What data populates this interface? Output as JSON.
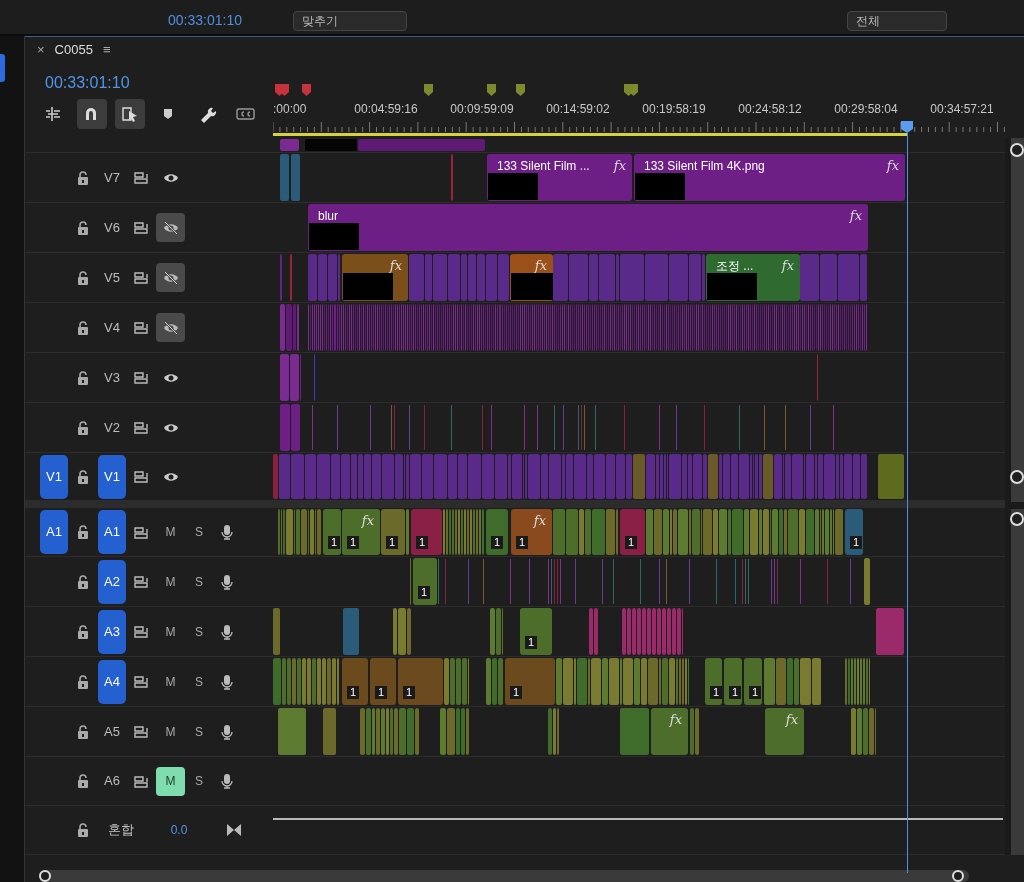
{
  "program_monitor": {
    "timecode": "00:33:01:10",
    "zoom_select": "맞추기",
    "quality_select": "전체"
  },
  "sequence": {
    "close": "×",
    "title": "C0055",
    "menu": "≡",
    "timecode": "00:33:01:10"
  },
  "tools": [
    {
      "kind": "insert",
      "selected": false
    },
    {
      "kind": "snap",
      "selected": true
    },
    {
      "kind": "linked",
      "selected": true
    },
    {
      "kind": "marker",
      "selected": false
    },
    {
      "kind": "settings",
      "selected": false
    },
    {
      "kind": "captions",
      "selected": false
    }
  ],
  "ruler": {
    "markers": [
      {
        "color": "#c8323c"
      },
      {
        "color": "#c8323c"
      },
      {
        "color": "#c8323c"
      },
      {
        "color": "#7d8a2e"
      },
      {
        "color": "#7d8a2e"
      },
      {
        "color": "#7d8a2e"
      },
      {
        "color": "#7d8a2e"
      },
      {
        "color": "#7d8a2e"
      }
    ],
    "timecodes": [
      ":00:00",
      "00:04:59:16",
      "00:09:59:09",
      "00:14:59:02",
      "00:19:58:19",
      "00:24:58:12",
      "00:29:58:04",
      "00:34:57:21"
    ]
  },
  "tracks": [
    {
      "kind": "video",
      "name": "V7",
      "targeted": false,
      "visible": true,
      "clips": [
        {
          "label": "133 Silent Film ...",
          "badge": "fx",
          "color": "#6e1f86"
        },
        {
          "label": "133 Silent Film 4K.png",
          "badge": "fx",
          "color": "#6e1f86"
        }
      ]
    },
    {
      "kind": "video",
      "name": "V6",
      "targeted": false,
      "visible": false,
      "clips": [
        {
          "label": "blur",
          "badge": "fx",
          "color": "#6e1f86"
        }
      ]
    },
    {
      "kind": "video",
      "name": "V5",
      "targeted": false,
      "visible": false,
      "clips": [
        {
          "badge": "fx",
          "color": "#7a4f1a"
        },
        {
          "badge": "fx",
          "color": "#9a5018"
        },
        {
          "label": "조정 ...",
          "badge": "fx",
          "color": "#2f6b31"
        }
      ]
    },
    {
      "kind": "video",
      "name": "V4",
      "targeted": false,
      "visible": false
    },
    {
      "kind": "video",
      "name": "V3",
      "targeted": false,
      "visible": true
    },
    {
      "kind": "video",
      "name": "V2",
      "targeted": false,
      "visible": true
    },
    {
      "kind": "video",
      "name": "V1",
      "source": "V1",
      "targeted": true,
      "visible": true
    },
    {
      "kind": "audio",
      "name": "A1",
      "source": "A1",
      "targeted": true,
      "muted": false,
      "mute_label": "M",
      "solo_label": "S",
      "clips": [
        {
          "label": "1",
          "color": "#4d6e2b"
        },
        {
          "label": "1",
          "badge": "fx",
          "color": "#4d6e2b"
        },
        {
          "label": "1",
          "color": "#6b6a2a"
        },
        {
          "label": "1",
          "color": "#8a2046"
        },
        {
          "label": "1",
          "color": "#3f6b2b"
        },
        {
          "label": "1",
          "badge": "fx",
          "color": "#8a4a1e"
        },
        {
          "label": "1",
          "color": "#8a2046"
        },
        {
          "label": "1",
          "color": "#2a5c7a"
        }
      ]
    },
    {
      "kind": "audio",
      "name": "A2",
      "targeted": true,
      "muted": false,
      "mute_label": "M",
      "solo_label": "S",
      "clips": [
        {
          "label": "1",
          "color": "#4d6e2b"
        }
      ]
    },
    {
      "kind": "audio",
      "name": "A3",
      "targeted": true,
      "muted": false,
      "mute_label": "M",
      "solo_label": "S",
      "clips": [
        {
          "label": "1",
          "color": "#4d6e2b"
        }
      ]
    },
    {
      "kind": "audio",
      "name": "A4",
      "targeted": true,
      "muted": false,
      "mute_label": "M",
      "solo_label": "S",
      "clips": [
        {
          "label": "1",
          "color": "#6b4a1e"
        },
        {
          "label": "1",
          "color": "#6b4a1e"
        },
        {
          "label": "1",
          "color": "#6b4a1e"
        },
        {
          "label": "1",
          "color": "#6b4a1e"
        },
        {
          "label": "1",
          "color": "#4d6e2b"
        },
        {
          "label": "1",
          "color": "#4d6e2b"
        },
        {
          "label": "1",
          "color": "#4d6e2b"
        }
      ]
    },
    {
      "kind": "audio",
      "name": "A5",
      "targeted": false,
      "muted": false,
      "mute_label": "M",
      "solo_label": "S",
      "clips": [
        {
          "badge": "fx",
          "color": "#4d6e2b"
        },
        {
          "badge": "fx",
          "color": "#4d6e2b"
        }
      ]
    },
    {
      "kind": "audio",
      "name": "A6",
      "targeted": false,
      "muted": true,
      "mute_label": "M",
      "solo_label": "S"
    }
  ],
  "mix": {
    "name": "혼합",
    "value": "0.0"
  }
}
